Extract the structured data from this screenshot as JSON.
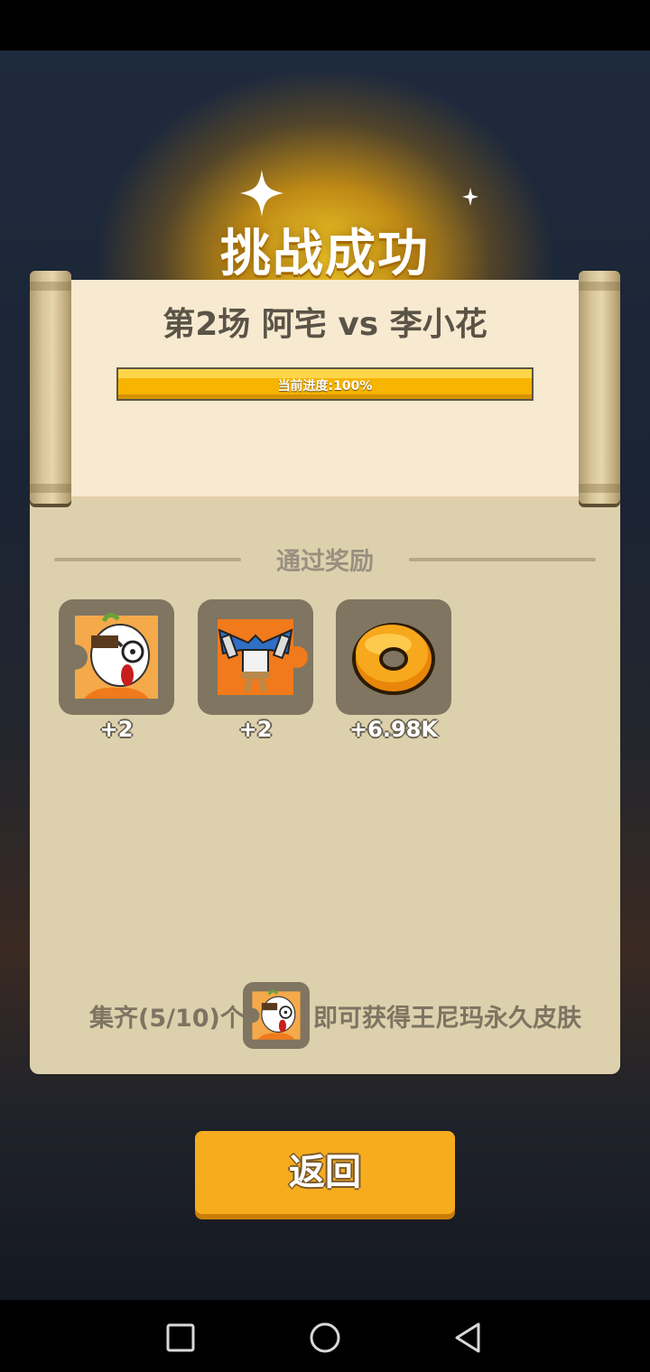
{
  "title": "挑战成功",
  "match": {
    "title": "第2场 阿宅 vs 李小花",
    "progress_text": "当前进度:100%",
    "progress_value": 1.0
  },
  "rewards": {
    "section_title": "通过奖励",
    "items": [
      {
        "icon": "character-puzzle-icon",
        "count": "+2"
      },
      {
        "icon": "outfit-puzzle-icon",
        "count": "+2"
      },
      {
        "icon": "donut-coin-icon",
        "count": "+6.98K"
      }
    ]
  },
  "collect": {
    "prefix": "集齐(5/10)个",
    "suffix": "即可获得王尼玛永久皮肤",
    "icon": "character-puzzle-icon"
  },
  "back_button": "返回",
  "nav": {
    "icons": [
      "recent-apps-icon",
      "home-icon",
      "back-icon"
    ]
  },
  "colors": {
    "accent": "#f7ac1e",
    "panel": "#ddd1ad",
    "paper": "#f8ead0",
    "progress": "#f7b400"
  }
}
